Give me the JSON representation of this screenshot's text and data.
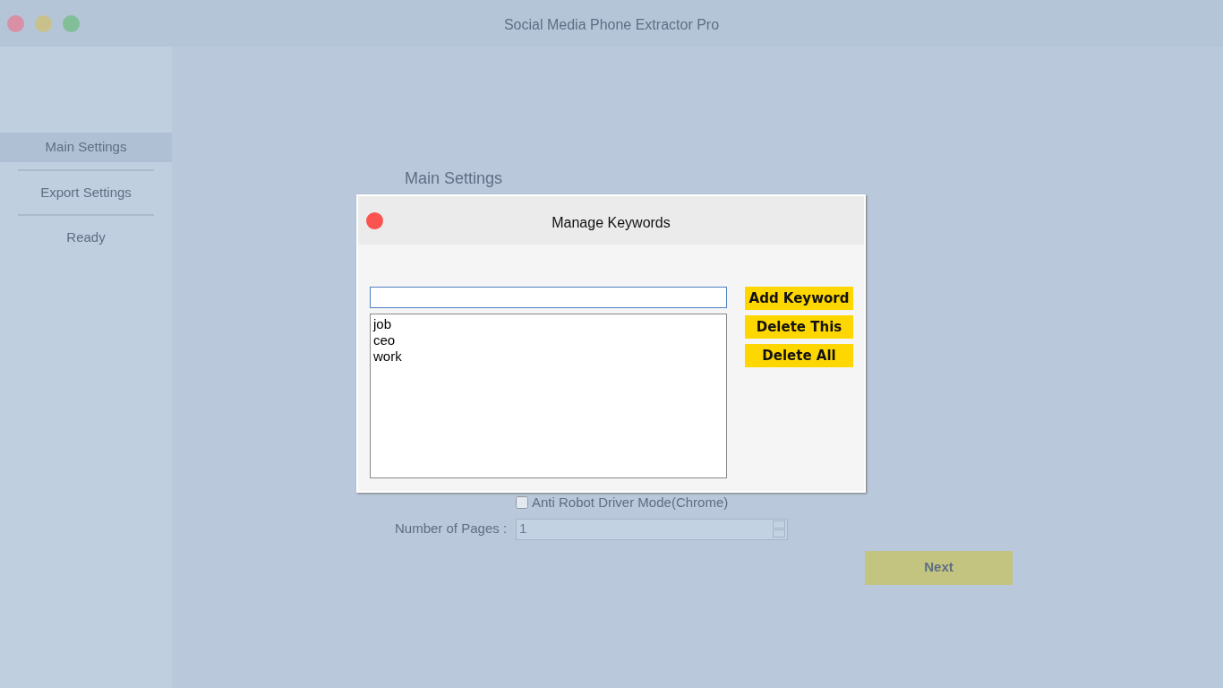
{
  "window": {
    "title": "Social Media Phone Extractor Pro",
    "controls": [
      {
        "color": "#d98fa6"
      },
      {
        "color": "#c9c18c"
      },
      {
        "color": "#82bf98"
      }
    ]
  },
  "sidebar": {
    "items": [
      {
        "label": "Main Settings",
        "selected": true
      },
      {
        "label": "Export Settings",
        "selected": false
      },
      {
        "label": "Ready",
        "selected": false
      }
    ]
  },
  "main": {
    "heading": "Main Settings",
    "anti_robot": {
      "label": "Anti Robot Driver Mode(Chrome)",
      "checked": false
    },
    "pages": {
      "label": "Number of Pages :",
      "value": "1"
    },
    "next_button": "Next"
  },
  "dialog": {
    "title": "Manage Keywords",
    "keywords": [
      "job",
      "ceo",
      "work"
    ],
    "buttons": [
      "Add Keyword",
      "Delete This",
      "Delete All"
    ]
  }
}
